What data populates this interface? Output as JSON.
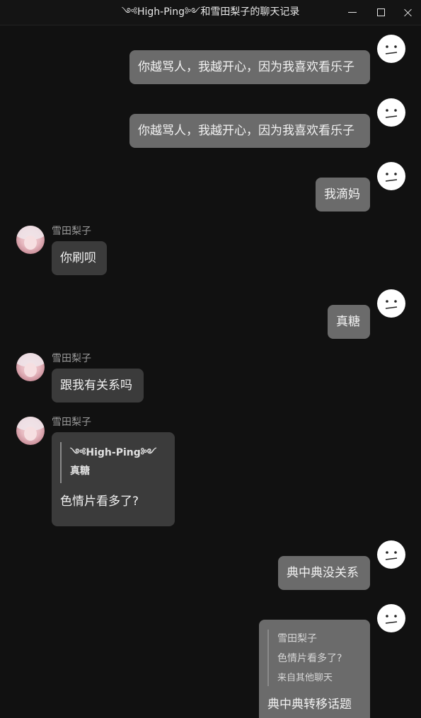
{
  "window": {
    "title": "༺High-Ping༻和雪田梨子的聊天记录"
  },
  "colors": {
    "background": "#111111",
    "my_bubble": "#6b6b6b",
    "their_bubble": "#3b3b3b",
    "name_text": "#9a9a9a"
  },
  "contact": {
    "name": "雪田梨子"
  },
  "messages": [
    {
      "sender": "me",
      "text": "你越骂人，我越开心，因为我喜欢看乐子"
    },
    {
      "sender": "me",
      "text": "你越骂人，我越开心，因为我喜欢看乐子"
    },
    {
      "sender": "me",
      "text": "我滴妈"
    },
    {
      "sender": "them",
      "name": "雪田梨子",
      "text": "你刷呗"
    },
    {
      "sender": "me",
      "text": "真糖"
    },
    {
      "sender": "them",
      "name": "雪田梨子",
      "text": "跟我有关系吗"
    },
    {
      "sender": "them",
      "name": "雪田梨子",
      "quote": {
        "author": "༺High-Ping༻",
        "text": "真糖"
      },
      "text": "色情片看多了?"
    },
    {
      "sender": "me",
      "text": "典中典没关系"
    },
    {
      "sender": "me",
      "quote": {
        "author": "雪田梨子",
        "text": "色情片看多了?",
        "source": "来自其他聊天"
      },
      "text": "典中典转移话题"
    }
  ]
}
